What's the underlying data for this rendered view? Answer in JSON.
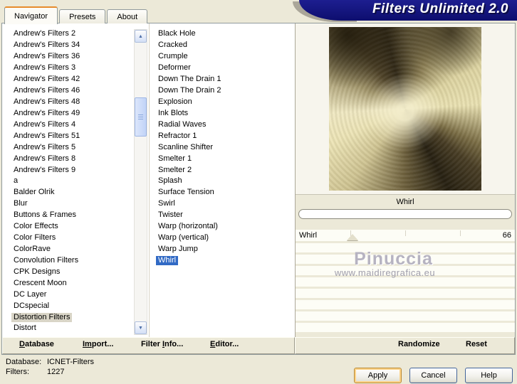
{
  "window": {
    "title": "Filters Unlimited 2.0"
  },
  "tabs": [
    {
      "label": "Navigator",
      "active": true
    },
    {
      "label": "Presets",
      "active": false
    },
    {
      "label": "About",
      "active": false
    }
  ],
  "category_list": {
    "items": [
      "Andrew's Filters 2",
      "Andrew's Filters 34",
      "Andrew's Filters 36",
      "Andrew's Filters 3",
      "Andrew's Filters 42",
      "Andrew's Filters 46",
      "Andrew's Filters 48",
      "Andrew's Filters 49",
      "Andrew's Filters 4",
      "Andrew's Filters 51",
      "Andrew's Filters 5",
      "Andrew's Filters 8",
      "Andrew's Filters 9",
      "a",
      "Balder Olrik",
      "Blur",
      "Buttons & Frames",
      "Color Effects",
      "Color Filters",
      "ColorRave",
      "Convolution Filters",
      "CPK Designs",
      "Crescent Moon",
      "DC Layer",
      "DCspecial",
      "Distortion Filters",
      "Distort"
    ],
    "selected": "Distortion Filters"
  },
  "filter_list": {
    "items": [
      "Black Hole",
      "Cracked",
      "Crumple",
      "Deformer",
      "Down The Drain 1",
      "Down The Drain 2",
      "Explosion",
      "Ink Blots",
      "Radial Waves",
      "Refractor 1",
      "Scanline Shifter",
      "Smelter 1",
      "Smelter 2",
      "Splash",
      "Surface Tension",
      "Swirl",
      "Twister",
      "Warp (horizontal)",
      "Warp (vertical)",
      "Warp Jump",
      "Whirl"
    ],
    "selected": "Whirl"
  },
  "preview": {
    "caption": "Whirl"
  },
  "parameters": {
    "slider": {
      "name": "Whirl",
      "value": "66",
      "thumb_percent": 26
    },
    "empty_row_count": 8
  },
  "watermark": {
    "line1": "Pinuccia",
    "line2": "www.maidiregrafica.eu"
  },
  "toolbar": {
    "left": [
      {
        "pre": "",
        "accel": "D",
        "post": "atabase"
      },
      {
        "pre": "",
        "accel": "Im",
        "post": "port..."
      },
      {
        "pre": "Filter ",
        "accel": "I",
        "post": "nfo..."
      },
      {
        "pre": "",
        "accel": "E",
        "post": "ditor..."
      }
    ],
    "right": [
      "Randomize",
      "Reset"
    ]
  },
  "status": {
    "database_label": "Database:",
    "database_value": "ICNET-Filters",
    "filters_label": "Filters:",
    "filters_value": "1227"
  },
  "action_buttons": [
    {
      "label": "Apply",
      "default": true
    },
    {
      "label": "Cancel",
      "default": false
    },
    {
      "label": "Help",
      "default": false
    }
  ],
  "colors": {
    "background": "#ece9d8",
    "banner": "#12127e",
    "selection": "#316ac5",
    "inactive_selection": "#d9d5c7",
    "active_tab_highlight": "#e68b2c"
  }
}
